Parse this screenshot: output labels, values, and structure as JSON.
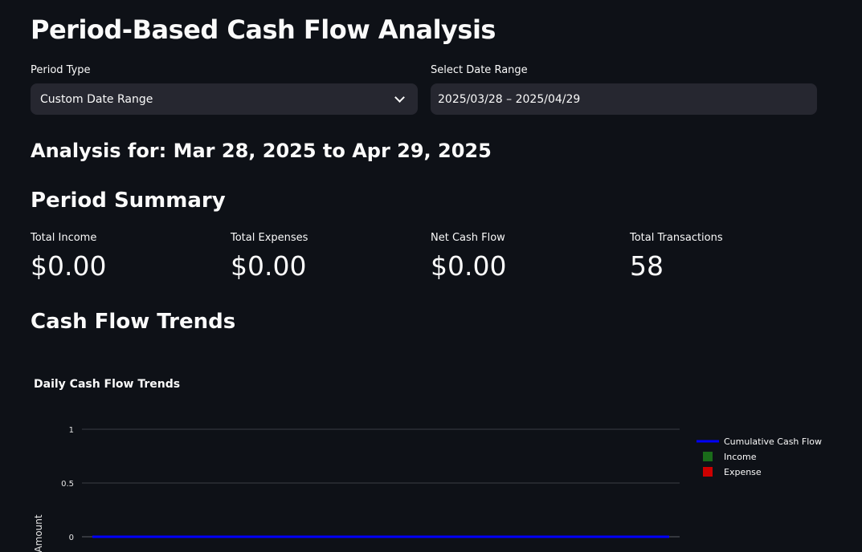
{
  "page": {
    "title": "Period-Based Cash Flow Analysis",
    "analysis_heading": "Analysis for: Mar 28, 2025 to Apr 29, 2025",
    "summary_heading": "Period Summary",
    "trends_heading": "Cash Flow Trends"
  },
  "filters": {
    "period_type": {
      "label": "Period Type",
      "value": "Custom Date Range"
    },
    "date_range": {
      "label": "Select Date Range",
      "value": "2025/03/28 – 2025/04/29"
    }
  },
  "metrics": [
    {
      "label": "Total Income",
      "value": "$0.00"
    },
    {
      "label": "Total Expenses",
      "value": "$0.00"
    },
    {
      "label": "Net Cash Flow",
      "value": "$0.00"
    },
    {
      "label": "Total Transactions",
      "value": "58"
    }
  ],
  "chart_data": {
    "type": "line",
    "title": "Daily Cash Flow Trends",
    "ylabel": "Amount",
    "xlabel": "",
    "ylim": [
      0,
      1
    ],
    "y_ticks": [
      "0",
      "0.5",
      "1"
    ],
    "grid": true,
    "legend_placement": "right",
    "series": [
      {
        "name": "Cumulative Cash Flow",
        "kind": "line",
        "color": "#0000ff",
        "values": [
          0,
          0
        ]
      },
      {
        "name": "Income",
        "kind": "bar",
        "color": "#1a6b1a",
        "values": []
      },
      {
        "name": "Expense",
        "kind": "bar",
        "color": "#cc0000",
        "values": []
      }
    ]
  }
}
